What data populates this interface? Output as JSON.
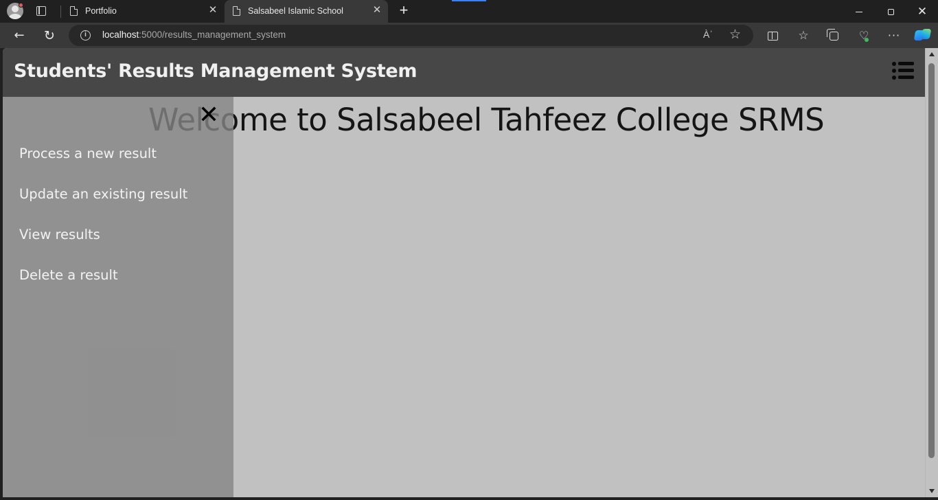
{
  "browser": {
    "tabs": [
      {
        "title": "Portfolio",
        "active": false
      },
      {
        "title": "Salsabeel Islamic School",
        "active": true
      }
    ],
    "new_tab_label": "+",
    "address": {
      "host": "localhost",
      "path": ":5000/results_management_system"
    },
    "read_aloud_label": "Àʾ",
    "icons": {
      "profile": "profile-avatar-icon",
      "tab_actions": "tab-actions-icon",
      "tab_page": "page-icon",
      "tab_close": "close-icon",
      "back": "arrow-left-icon",
      "reload": "reload-icon",
      "info": "info-icon",
      "read_aloud": "read-aloud-icon",
      "favorite": "star-icon",
      "split_screen": "split-screen-icon",
      "favorites": "favorites-icon",
      "collections": "collections-icon",
      "performance": "heart-pulse-icon",
      "more": "more-icon",
      "copilot": "copilot-icon",
      "minimize": "minimize-icon",
      "restore": "restore-icon",
      "close": "close-icon"
    }
  },
  "page": {
    "title": "Students' Results Management System",
    "welcome": "Welcome to Salsabeel Tahfeez College SRMS",
    "menu_toggle_icon": "list-icon",
    "sidenav": {
      "close_label": "✕",
      "links": [
        {
          "label": "Process a new result"
        },
        {
          "label": "Update an existing result"
        },
        {
          "label": "View results"
        },
        {
          "label": "Delete a result"
        }
      ]
    }
  },
  "colors": {
    "chrome_bg": "#202020",
    "toolbar_bg": "#393939",
    "header_bg": "#474747",
    "page_bg": "#c1c1c1",
    "sidenav_bg": "#848484",
    "text_light": "#f3f3f3",
    "text_dark": "#151515"
  }
}
